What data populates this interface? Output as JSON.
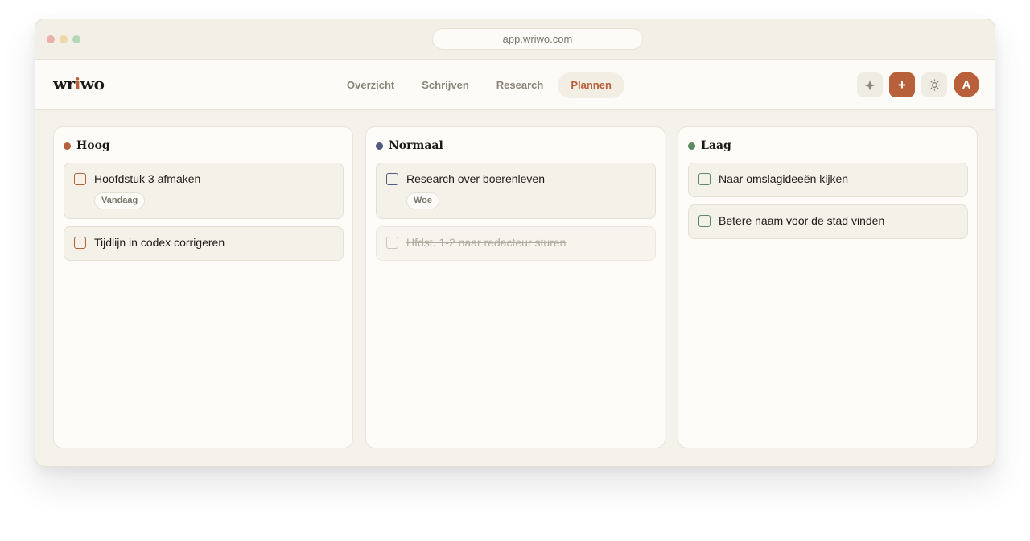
{
  "browser": {
    "url": "app.wriwo.com"
  },
  "app": {
    "logo_pre": "wr",
    "logo_accent": "i",
    "logo_post": "wo",
    "nav": [
      "Overzicht",
      "Schrijven",
      "Research",
      "Plannen"
    ],
    "active_nav": "Plannen",
    "add_button": "+",
    "avatar_initial": "A"
  },
  "columns": [
    {
      "title": "Hoog",
      "color": "#b7603a",
      "tasks": [
        {
          "text": "Hoofdstuk 3 afmaken",
          "tag": "Vandaag",
          "done": false
        },
        {
          "text": "Tijdlijn in codex corrigeren",
          "tag": null,
          "done": false
        }
      ]
    },
    {
      "title": "Normaal",
      "color": "#4f5a7e",
      "tasks": [
        {
          "text": "Research over boerenleven",
          "tag": "Woe",
          "done": false
        },
        {
          "text": "Hfdst. 1-2 naar redacteur sturen",
          "tag": null,
          "done": true
        }
      ]
    },
    {
      "title": "Laag",
      "color": "#5c8a5e",
      "tasks": [
        {
          "text": "Naar omslagideeën kijken",
          "tag": null,
          "done": false
        },
        {
          "text": "Betere naam voor de stad vinden",
          "tag": null,
          "done": false
        }
      ]
    }
  ],
  "icons": {
    "sparkle": "sparkle-icon",
    "theme": "sun-icon"
  }
}
